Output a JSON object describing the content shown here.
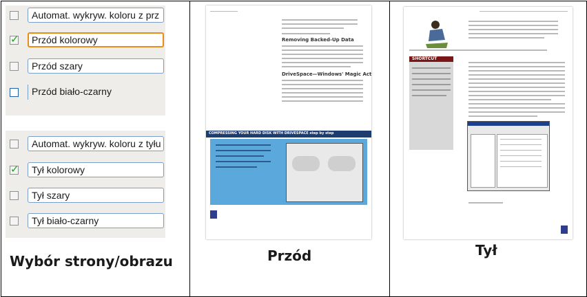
{
  "front_options": [
    {
      "label": "Automat. wykryw. koloru z prz",
      "checked": false,
      "selected": false
    },
    {
      "label": "Przód kolorowy",
      "checked": true,
      "selected": true
    },
    {
      "label": "Przód szary",
      "checked": false,
      "selected": false
    },
    {
      "label": "Przód biało-czarny",
      "checked": false,
      "selected": false
    }
  ],
  "back_options": [
    {
      "label": "Automat. wykryw. koloru z tyłu",
      "checked": false
    },
    {
      "label": "Tył kolorowy",
      "checked": true
    },
    {
      "label": "Tył szary",
      "checked": false
    },
    {
      "label": "Tył biało-czarny",
      "checked": false
    }
  ],
  "captions": {
    "selection": "Wybór strony/obrazu",
    "front": "Przód",
    "back": "Tył"
  },
  "doc_front": {
    "heading1": "Removing Backed-Up Data",
    "heading2": "DriveSpace—Windows' Magic Act",
    "banner": "COMPRESSING YOUR HARD DISK WITH DRIVESPACE step by step"
  },
  "doc_back": {
    "sidebar_title": "SHORTCUT"
  },
  "colors": {
    "checkmark": "#20a020",
    "selected_border": "#e98b17",
    "field_border": "#7a9ec7",
    "banner": "#1c3d6e"
  }
}
